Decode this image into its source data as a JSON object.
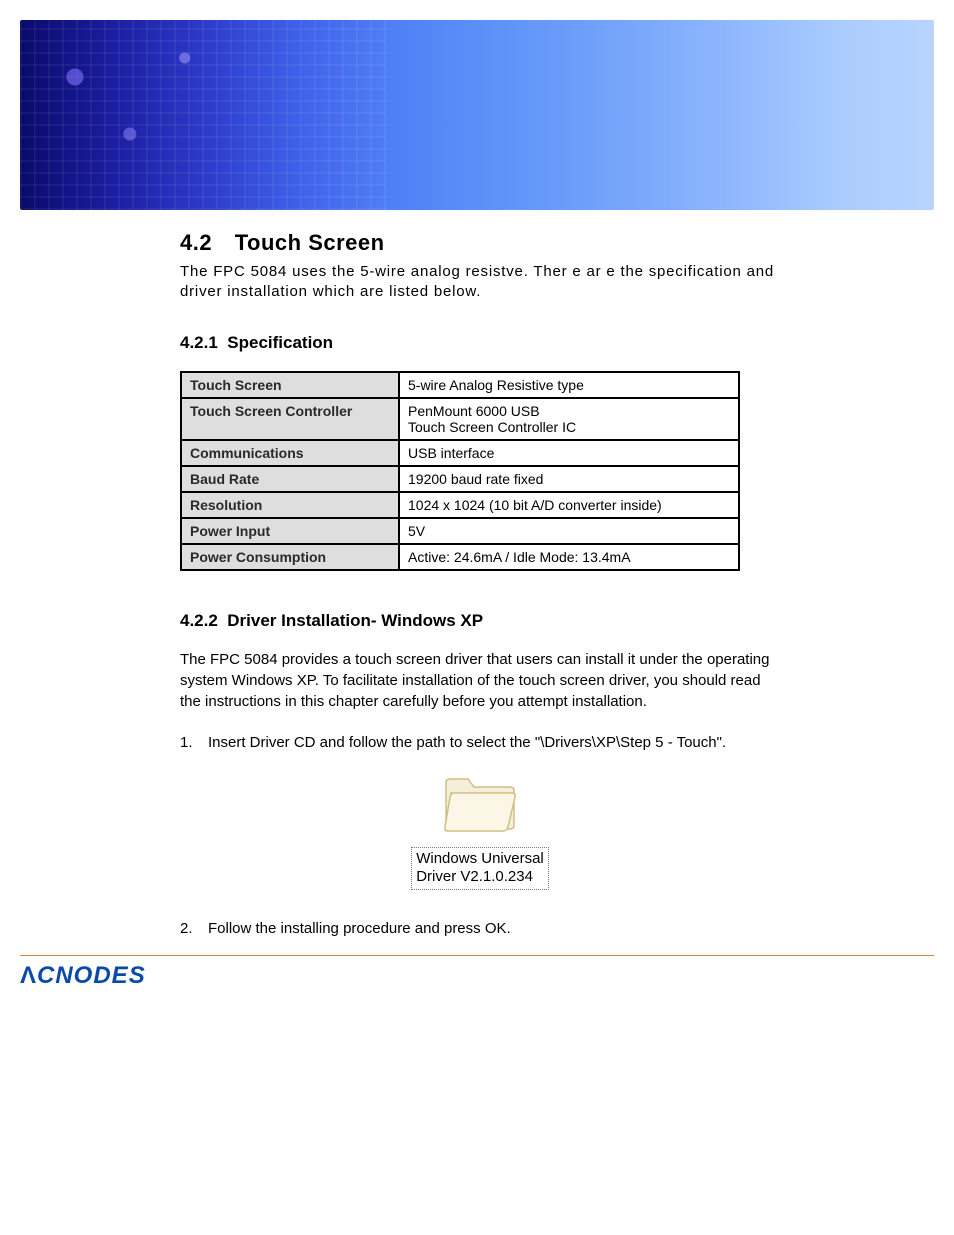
{
  "section": {
    "number": "4.2",
    "title": "Touch Screen",
    "intro": "The FPC 5084 uses the 5-wire analog resistve. Ther e ar e the specification and driver installation which are listed below."
  },
  "spec_section": {
    "number": "4.2.1",
    "title": "Specification",
    "rows": [
      {
        "label": "Touch Screen",
        "value": "5-wire Analog Resistive type"
      },
      {
        "label": "Touch Screen Controller",
        "value": "PenMount 6000 USB\nTouch Screen Controller IC"
      },
      {
        "label": "Communications",
        "value": "USB interface"
      },
      {
        "label": "Baud Rate",
        "value": "19200 baud rate fixed"
      },
      {
        "label": "Resolution",
        "value": "1024 x 1024  (10 bit A/D converter inside)"
      },
      {
        "label": "Power Input",
        "value": "5V"
      },
      {
        "label": "Power Consumption",
        "value": "Active: 24.6mA / Idle Mode: 13.4mA"
      }
    ]
  },
  "driver_section": {
    "number": "4.2.2",
    "title": "Driver Installation- Windows XP",
    "para": "The FPC 5084 provides a touch screen driver that users can install it under the operating system Windows XP. To facilitate installation of the touch screen driver, you should read the instructions in this chapter carefully before you attempt installation.",
    "steps": [
      {
        "n": "1.",
        "t": "Insert Driver CD and follow the path to select the \"\\Drivers\\XP\\Step 5 - Touch\"."
      },
      {
        "n": "2.",
        "t": "Follow the installing procedure and press OK."
      }
    ],
    "folder_label_line1": "Windows Universal",
    "folder_label_line2": "Driver V2.1.0.234"
  },
  "brand": "CNODES"
}
